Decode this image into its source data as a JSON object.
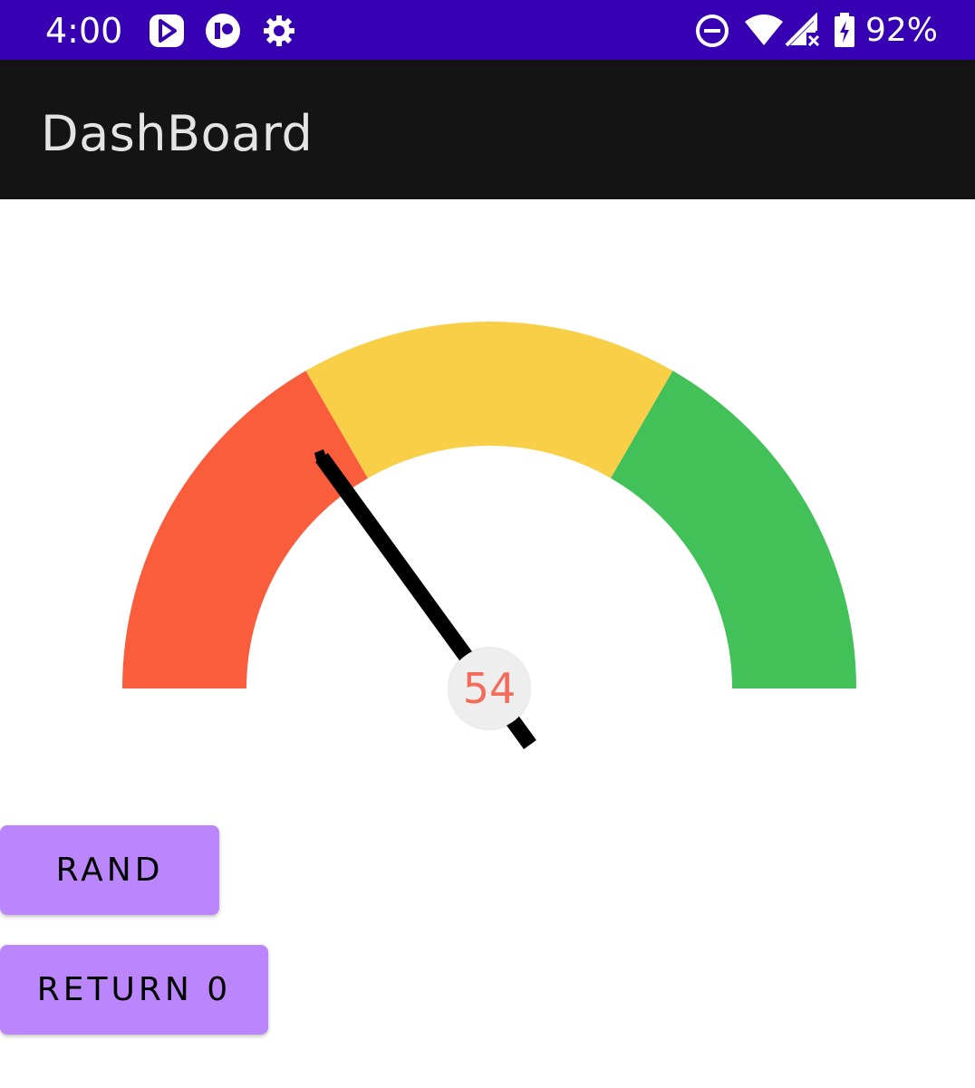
{
  "status_bar": {
    "time": "4:00",
    "battery": "92%",
    "background_color": "#3700b3",
    "icons": [
      "play-store-icon",
      "app-icon",
      "settings-gear-icon",
      "do-not-disturb-icon",
      "wifi-icon",
      "signal-icon",
      "battery-charging-icon"
    ]
  },
  "app_bar": {
    "title": "DashBoard",
    "background_color": "#141414"
  },
  "gauge": {
    "value": "54",
    "segments": [
      {
        "color": "#fa5d3b"
      },
      {
        "color": "#f8cf47"
      },
      {
        "color": "#41c158"
      }
    ],
    "needle_color": "#000000",
    "value_color": "#f36b5a"
  },
  "buttons": {
    "rand_label": "RAND",
    "return_label": "RETURN 0",
    "color": "#bb86fc"
  }
}
